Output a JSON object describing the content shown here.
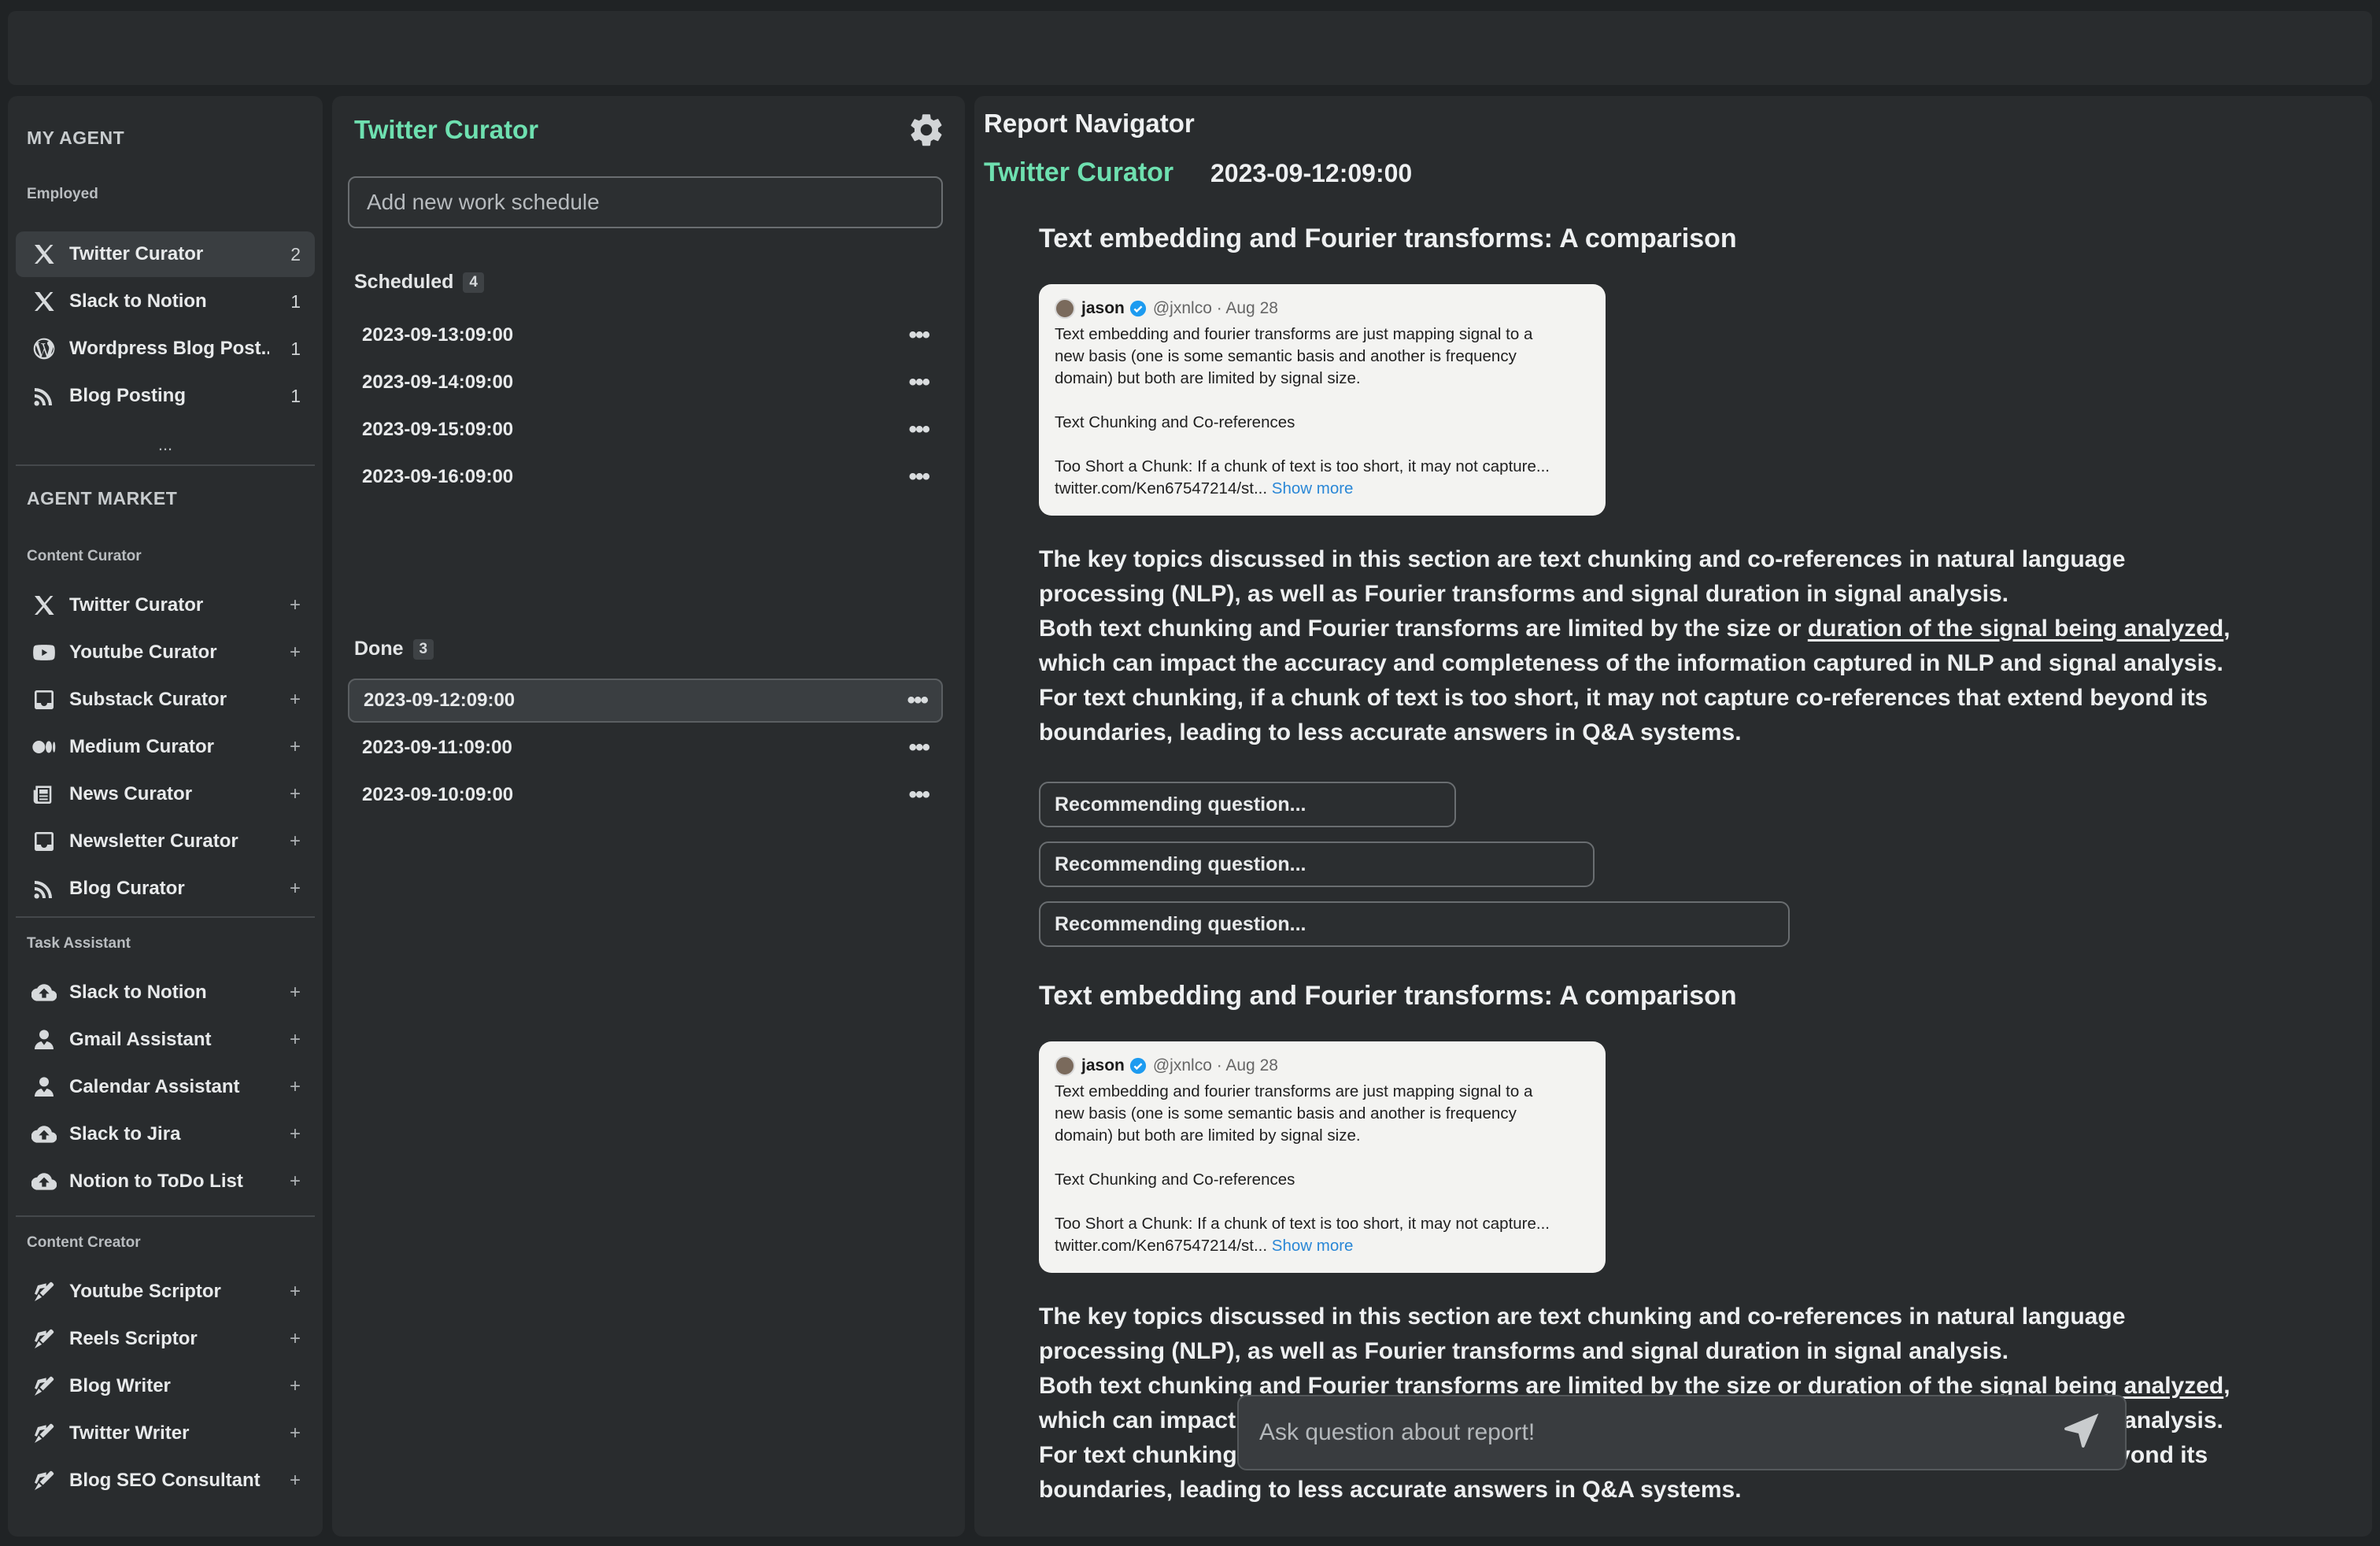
{
  "sidebar": {
    "my_agent_heading": "MY AGENT",
    "employed_label": "Employed",
    "employed": [
      {
        "label": "Twitter Curator",
        "count": "2",
        "icon": "x-logo-icon"
      },
      {
        "label": "Slack to Notion",
        "count": "1",
        "icon": "x-logo-icon"
      },
      {
        "label": "Wordpress Blog Post...",
        "count": "1",
        "icon": "wordpress-icon"
      },
      {
        "label": "Blog Posting",
        "count": "1",
        "icon": "rss-icon"
      }
    ],
    "more": "...",
    "market_heading": "AGENT MARKET",
    "plus": "+",
    "groups": [
      {
        "label": "Content Curator",
        "items": [
          {
            "label": "Twitter Curator",
            "icon": "x-logo-icon"
          },
          {
            "label": "Youtube Curator",
            "icon": "youtube-icon"
          },
          {
            "label": "Substack Curator",
            "icon": "inbox-icon"
          },
          {
            "label": "Medium Curator",
            "icon": "medium-icon"
          },
          {
            "label": "News Curator",
            "icon": "newspaper-icon"
          },
          {
            "label": "Newsletter Curator",
            "icon": "inbox-icon"
          },
          {
            "label": "Blog Curator",
            "icon": "rss-icon"
          }
        ]
      },
      {
        "label": "Task Assistant",
        "items": [
          {
            "label": "Slack to Notion",
            "icon": "cloud-upload-icon"
          },
          {
            "label": "Gmail Assistant",
            "icon": "user-tie-icon"
          },
          {
            "label": "Calendar Assistant",
            "icon": "user-tie-icon"
          },
          {
            "label": "Slack to Jira",
            "icon": "cloud-upload-icon"
          },
          {
            "label": "Notion to ToDo List",
            "icon": "cloud-upload-icon"
          }
        ]
      },
      {
        "label": "Content Creator",
        "items": [
          {
            "label": "Youtube Scriptor",
            "icon": "pen-icon"
          },
          {
            "label": "Reels Scriptor",
            "icon": "pen-icon"
          },
          {
            "label": "Blog Writer",
            "icon": "pen-icon"
          },
          {
            "label": "Twitter Writer",
            "icon": "pen-icon"
          },
          {
            "label": "Blog SEO Consultant",
            "icon": "pen-icon"
          }
        ]
      }
    ]
  },
  "schedule": {
    "title": "Twitter Curator",
    "input_placeholder": "Add new work schedule",
    "scheduled_label": "Scheduled",
    "scheduled_count": "4",
    "scheduled": [
      "2023-09-13:09:00",
      "2023-09-14:09:00",
      "2023-09-15:09:00",
      "2023-09-16:09:00"
    ],
    "done_label": "Done",
    "done_count": "3",
    "done": [
      "2023-09-12:09:00",
      "2023-09-11:09:00",
      "2023-09-10:09:00"
    ],
    "menu_glyph": "•••"
  },
  "report": {
    "title": "Report Navigator",
    "agent": "Twitter Curator",
    "date": "2023-09-12:09:00",
    "sections": [
      {
        "heading": "Text embedding and Fourier transforms: A comparison",
        "tweet": {
          "name": "jason",
          "handle": "@jxnlco · Aug 28",
          "lines": [
            "Text embedding and fourier transforms are just mapping signal to a",
            "new basis (one is some semantic basis and another is frequency",
            "domain) but both are limited by signal size."
          ],
          "line2": "Text Chunking and Co-references",
          "line3": "Too Short a Chunk: If a chunk of text is too short, it may not capture...",
          "link": "twitter.com/Ken67547214/st...",
          "show_more": "Show more"
        },
        "summary_p1": "The key topics discussed in this section are text chunking and co-references in natural language processing (NLP), as well as Fourier transforms and signal duration in signal analysis.",
        "summary_p2_a": "Both text chunking and Fourier transforms are limited by the size or ",
        "summary_p2_link": "duration of the signal being analyzed",
        "summary_p2_b": ", which can impact the accuracy and completeness of the information captured in NLP and signal analysis.",
        "summary_p3": "For text chunking, if a chunk of text is too short, it may not capture co-references that extend beyond its boundaries, leading to less accurate answers in Q&A systems.",
        "questions": [
          "Recommending question...",
          "Recommending question...",
          "Recommending question..."
        ]
      },
      {
        "heading": "Text embedding and Fourier transforms: A comparison",
        "tweet": {
          "name": "jason",
          "handle": "@jxnlco · Aug 28",
          "lines": [
            "Text embedding and fourier transforms are just mapping signal to a",
            "new basis (one is some semantic basis and another is frequency",
            "domain) but both are limited by signal size."
          ],
          "line2": "Text Chunking and Co-references",
          "line3": "Too Short a Chunk: If a chunk of text is too short, it may not capture...",
          "link": "twitter.com/Ken67547214/st...",
          "show_more": "Show more"
        },
        "summary_p1": "The key topics discussed in this section are text chunking and co-references in natural language processing (NLP), as well as Fourier transforms and signal duration in signal analysis.",
        "summary_p2_a": "Both text chunking and Fourier transforms are limited by the size or ",
        "summary_p2_link": "duration of the signal being analyzed",
        "summary_p2_b": ", which can impact the accuracy and completeness of the information captured in NLP and signal analysis.",
        "summary_p3": "For text chunking, if a chunk of text is too short, it may not capture co-references that extend beyond its boundaries, leading to less accurate answers in Q&A systems."
      }
    ],
    "ask_placeholder": "Ask question about report!"
  },
  "colors": {
    "accent": "#6ee0b0",
    "background": "#202325",
    "panel": "#292c2e",
    "link": "#2a87d6"
  }
}
